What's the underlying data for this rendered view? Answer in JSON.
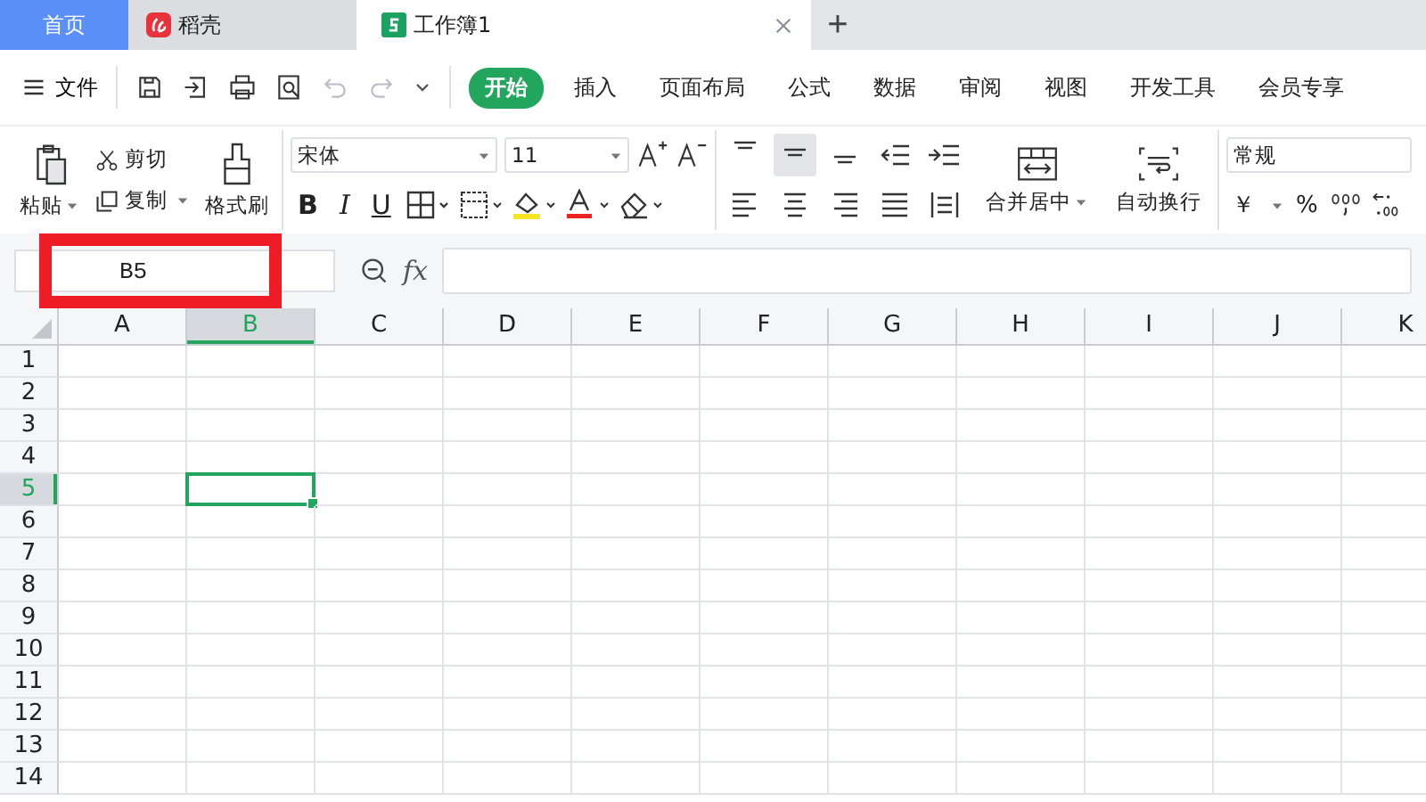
{
  "tabs": [
    {
      "label": "首页",
      "kind": "home",
      "selected": false
    },
    {
      "label": "稻壳",
      "kind": "docer",
      "selected": false
    },
    {
      "label": "工作簿1",
      "kind": "sheet",
      "selected": true
    }
  ],
  "new_tab": "+",
  "menu": {
    "file": "文件",
    "undo": {
      "disabled": true
    },
    "redo": {
      "disabled": true
    }
  },
  "ribbon_tabs": [
    {
      "label": "开始",
      "selected": true
    },
    {
      "label": "插入",
      "selected": false
    },
    {
      "label": "页面布局",
      "selected": false
    },
    {
      "label": "公式",
      "selected": false
    },
    {
      "label": "数据",
      "selected": false
    },
    {
      "label": "审阅",
      "selected": false
    },
    {
      "label": "视图",
      "selected": false
    },
    {
      "label": "开发工具",
      "selected": false
    },
    {
      "label": "会员专享",
      "selected": false
    }
  ],
  "clipboard": {
    "paste": "粘贴",
    "cut": "剪切",
    "copy": "复制",
    "format_painter": "格式刷"
  },
  "font": {
    "name": "宋体",
    "size": "11",
    "bold": "B",
    "italic": "I",
    "underline": "U"
  },
  "vertical_align": [
    {
      "kind": "top",
      "selected": false
    },
    {
      "kind": "middle",
      "selected": true
    },
    {
      "kind": "bottom",
      "selected": false
    }
  ],
  "alignment": {
    "merge": "合并居中",
    "wrap": "自动换行"
  },
  "number": {
    "format": "常规",
    "currency": "￥",
    "percent": "%"
  },
  "name_box": {
    "value": "B5",
    "highlighted": true
  },
  "formula_bar": {
    "fx": "fx"
  },
  "columns": [
    {
      "label": "A",
      "selected": false
    },
    {
      "label": "B",
      "selected": true
    },
    {
      "label": "C",
      "selected": false
    },
    {
      "label": "D",
      "selected": false
    },
    {
      "label": "E",
      "selected": false
    },
    {
      "label": "F",
      "selected": false
    },
    {
      "label": "G",
      "selected": false
    },
    {
      "label": "H",
      "selected": false
    },
    {
      "label": "I",
      "selected": false
    },
    {
      "label": "J",
      "selected": false
    },
    {
      "label": "K",
      "selected": false
    }
  ],
  "rows": [
    {
      "label": "1",
      "selected": false
    },
    {
      "label": "2",
      "selected": false
    },
    {
      "label": "3",
      "selected": false
    },
    {
      "label": "4",
      "selected": false
    },
    {
      "label": "5",
      "selected": true
    },
    {
      "label": "6",
      "selected": false
    },
    {
      "label": "7",
      "selected": false
    },
    {
      "label": "8",
      "selected": false
    },
    {
      "label": "9",
      "selected": false
    },
    {
      "label": "10",
      "selected": false
    },
    {
      "label": "11",
      "selected": false
    },
    {
      "label": "12",
      "selected": false
    },
    {
      "label": "13",
      "selected": false
    },
    {
      "label": "14",
      "selected": false
    }
  ]
}
